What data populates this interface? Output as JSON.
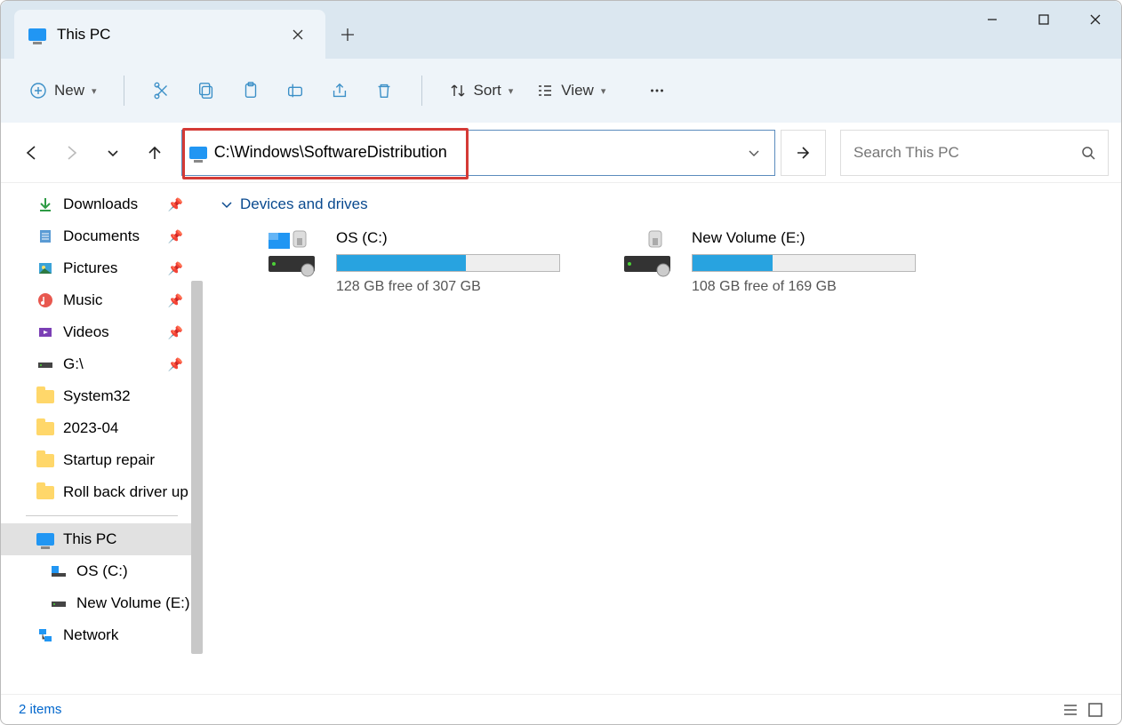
{
  "tab": {
    "title": "This PC"
  },
  "toolbar": {
    "new_label": "New",
    "sort_label": "Sort",
    "view_label": "View"
  },
  "address": {
    "path": "C:\\Windows\\SoftwareDistribution"
  },
  "search": {
    "placeholder": "Search This PC"
  },
  "sidebar": {
    "items": [
      {
        "label": "Downloads",
        "pinned": true,
        "icon": "download"
      },
      {
        "label": "Documents",
        "pinned": true,
        "icon": "document"
      },
      {
        "label": "Pictures",
        "pinned": true,
        "icon": "pictures"
      },
      {
        "label": "Music",
        "pinned": true,
        "icon": "music"
      },
      {
        "label": "Videos",
        "pinned": true,
        "icon": "videos"
      },
      {
        "label": "G:\\",
        "pinned": true,
        "icon": "drive"
      },
      {
        "label": "System32",
        "pinned": false,
        "icon": "folder"
      },
      {
        "label": "2023-04",
        "pinned": false,
        "icon": "folder"
      },
      {
        "label": "Startup repair",
        "pinned": false,
        "icon": "folder"
      },
      {
        "label": "Roll back driver up",
        "pinned": false,
        "icon": "folder"
      }
    ],
    "this_pc": "This PC",
    "os_c": "OS (C:)",
    "new_vol": "New Volume (E:)",
    "network": "Network"
  },
  "section": {
    "title": "Devices and drives"
  },
  "drives": [
    {
      "name": "OS (C:)",
      "free_text": "128 GB free of 307 GB",
      "fill_pct": 58
    },
    {
      "name": "New Volume (E:)",
      "free_text": "108 GB free of 169 GB",
      "fill_pct": 36
    }
  ],
  "status": {
    "text": "2 items"
  }
}
